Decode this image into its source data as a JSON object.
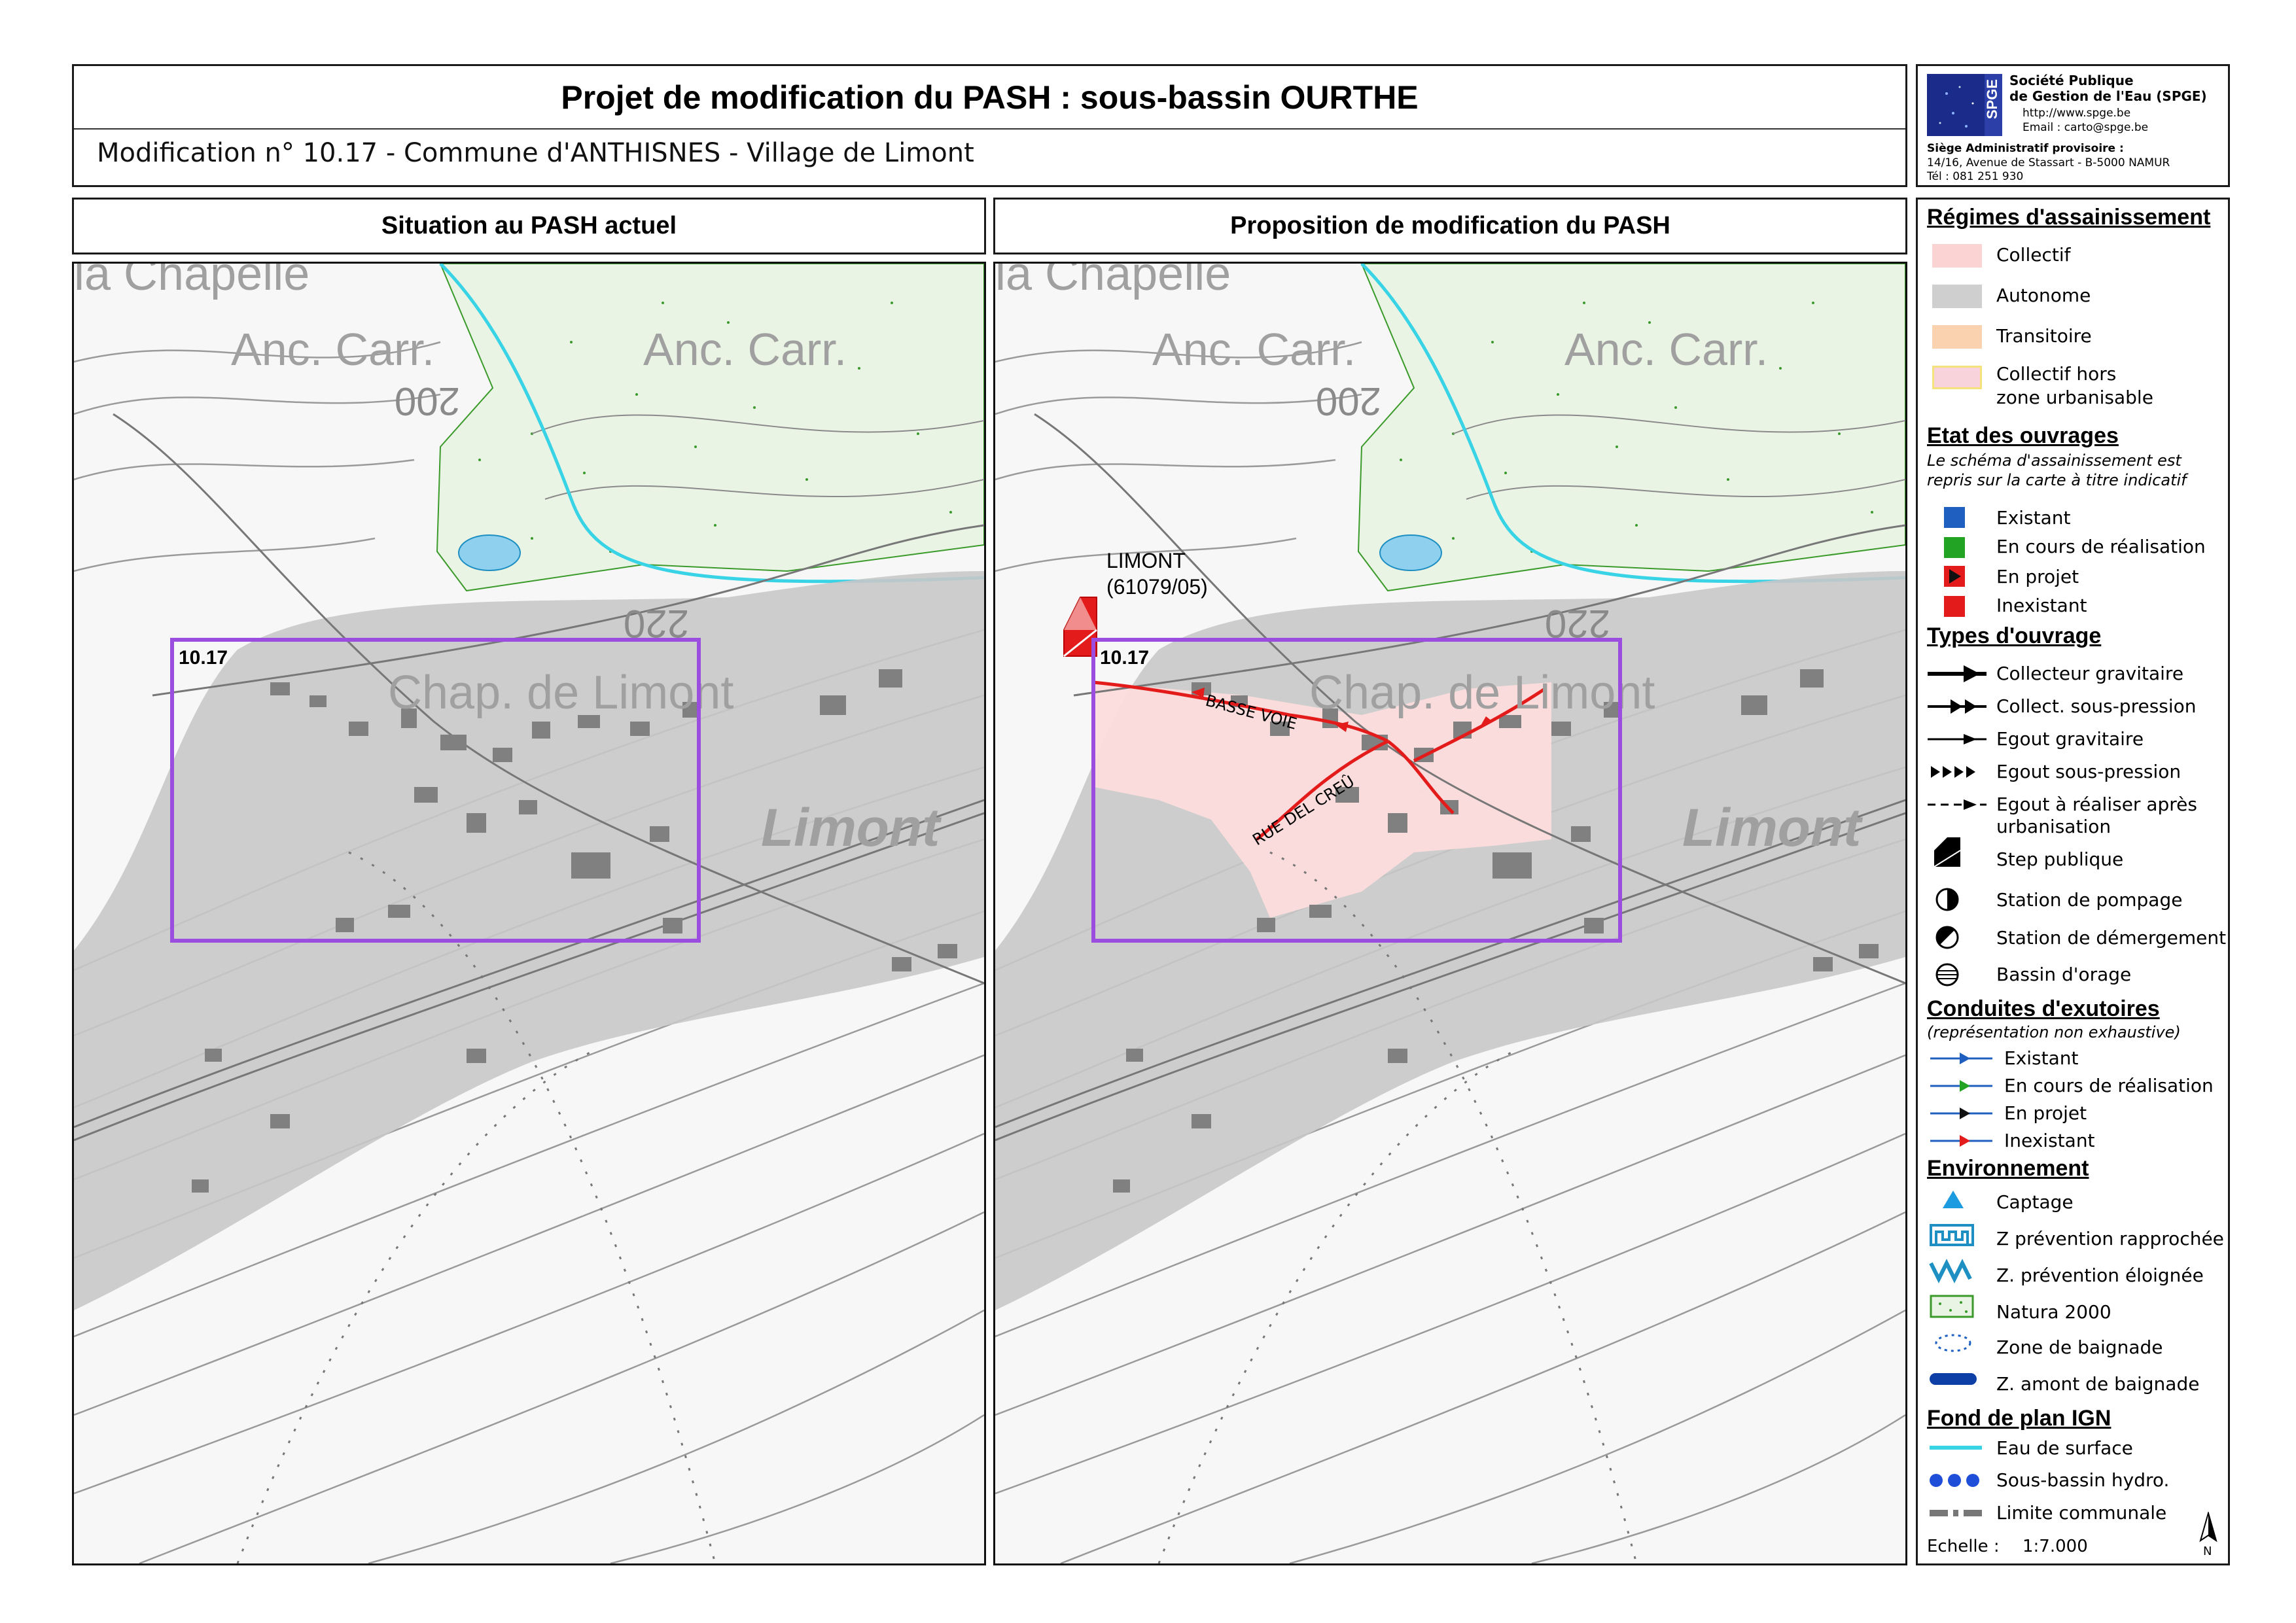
{
  "header": {
    "title": "Projet de modification du PASH : sous-bassin OURTHE",
    "subtitle": "Modification n° 10.17 - Commune d'ANTHISNES - Village de Limont"
  },
  "org": {
    "logo_text": "SPGE",
    "logo_small": "Société Publique de Gestion de l'Eau",
    "name_line1": "Société Publique",
    "name_line2": "de Gestion de l'Eau (SPGE)",
    "url": "http://www.spge.be",
    "email": "Email : carto@spge.be",
    "seat_title": "Siège Administratif provisoire :",
    "address": "14/16, Avenue de Stassart - B-5000 NAMUR",
    "phone": "Tél : 081 251 930"
  },
  "panels": {
    "left_title": "Situation au PASH actuel",
    "right_title": "Proposition de modification du PASH"
  },
  "map_labels": {
    "chapelle": "la Chapelle",
    "anc_carr": "Anc. Carr.",
    "contour_200": "200",
    "contour_220": "220",
    "chap_limont": "Chap. de Limont",
    "limont": "Limont",
    "zone_id": "10.17",
    "step_name": "LIMONT",
    "step_code": "(61079/05)",
    "street_1": "BASSE VOIE",
    "street_2": "RUE DEL CREÛ"
  },
  "legend": {
    "regimes_title": "Régimes d'assainissement",
    "regimes": [
      {
        "label": "Collectif",
        "color": "#fbd3d3"
      },
      {
        "label": "Autonome",
        "color": "#cfcfcf"
      },
      {
        "label": "Transitoire",
        "color": "#fbd2b0"
      },
      {
        "label": "Collectif hors",
        "color": "#f8d3dc"
      },
      {
        "label": "zone urbanisable",
        "color": ""
      }
    ],
    "etat_title": "Etat des ouvrages",
    "etat_note_1": "Le schéma d'assainissement est",
    "etat_note_2": "repris sur la carte à titre indicatif",
    "etat": [
      {
        "label": "Existant",
        "color": "#1f5fbf"
      },
      {
        "label": "En cours de réalisation",
        "color": "#23a323"
      },
      {
        "label": "En projet",
        "color": "#e31b1b"
      },
      {
        "label": "Inexistant",
        "color": "#e31b1b"
      }
    ],
    "types_title": "Types d'ouvrage",
    "types": [
      {
        "label": "Collecteur gravitaire",
        "icon": "collector-gravity-icon"
      },
      {
        "label": "Collect. sous-pression",
        "icon": "collector-pressure-icon"
      },
      {
        "label": "Egout gravitaire",
        "icon": "sewer-gravity-icon"
      },
      {
        "label": "Egout sous-pression",
        "icon": "sewer-pressure-icon"
      },
      {
        "label": "Egout à réaliser après",
        "icon": "sewer-future-icon"
      },
      {
        "label": "urbanisation",
        "icon": ""
      },
      {
        "label": "Step publique",
        "icon": "step-icon"
      },
      {
        "label": "Station de pompage",
        "icon": "pump-station-icon"
      },
      {
        "label": "Station de démergement",
        "icon": "drainage-station-icon"
      },
      {
        "label": "Bassin d'orage",
        "icon": "storm-basin-icon"
      }
    ],
    "conduites_title": "Conduites d'exutoires",
    "conduites_note": "(représentation non exhaustive)",
    "conduites": [
      {
        "label": "Existant",
        "color": "#1f5fbf"
      },
      {
        "label": "En cours de réalisation",
        "color": "#23a323"
      },
      {
        "label": "En projet",
        "color": "#111111"
      },
      {
        "label": "Inexistant",
        "color": "#e31b1b"
      }
    ],
    "env_title": "Environnement",
    "env": [
      {
        "label": "Captage",
        "icon": "catchment-triangle-icon"
      },
      {
        "label": "Z prévention rapprochée",
        "icon": "prevention-close-icon"
      },
      {
        "label": "Z. prévention éloignée",
        "icon": "prevention-far-icon"
      },
      {
        "label": "Natura 2000",
        "icon": "natura-icon"
      },
      {
        "label": "Zone de baignade",
        "icon": "bathing-zone-icon"
      },
      {
        "label": "Z. amont de baignade",
        "icon": "upstream-bathing-icon"
      }
    ],
    "ign_title": "Fond de plan IGN",
    "ign": [
      {
        "label": "Eau de surface",
        "color": "#39d3e6"
      },
      {
        "label": "Sous-bassin hydro.",
        "color": "#1f4fd8"
      },
      {
        "label": "Limite communale",
        "color": "#777777"
      }
    ],
    "scale_label": "Echelle :",
    "scale_value": "1:7.000",
    "north": "N"
  },
  "colors": {
    "autonome": "#c8c8c8",
    "collectif": "#fcdcdc",
    "frame": "#9b4de0",
    "network": "#e31b1b",
    "water": "#39d3e6",
    "natura": "#4a9a2a"
  }
}
